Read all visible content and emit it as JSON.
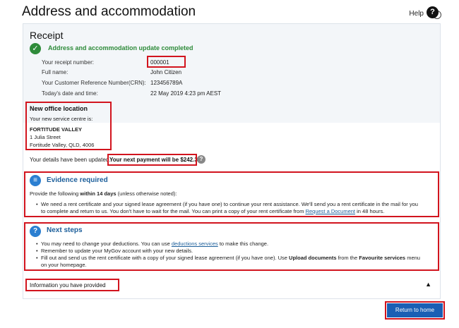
{
  "page": {
    "title": "Address and accommodation",
    "help_label": "Help"
  },
  "receipt": {
    "title": "Receipt",
    "status": "Address and accommodation update completed",
    "fields": [
      {
        "label": "Your receipt number:",
        "value": "000001"
      },
      {
        "label": "Full name:",
        "value": "John Citizen"
      },
      {
        "label": "Your Customer Reference Number(CRN):",
        "value": "123456789A"
      },
      {
        "label": "Today's date and time:",
        "value": "22 May 2019 4:23 pm AEST"
      }
    ]
  },
  "office": {
    "title": "New office location",
    "intro": "Your new service centre is:",
    "name": "FORTITUDE VALLEY",
    "street": "1 Julia Street",
    "suburb": "Fortitude Valley, QLD, 4006"
  },
  "payment": {
    "details_text": "Your details have been updated.",
    "next_payment": "Your next payment will be $242.34"
  },
  "evidence": {
    "title": "Evidence required",
    "intro_pre": "Provide the following ",
    "intro_bold": "within 14 days",
    "intro_post": " (unless otherwise noted):",
    "bullet_line1": "We need a rent certificate and your signed lease agreement (if you have one) to continue your rent assistance. We'll send you a rent certificate in the mail for you",
    "bullet_line2_pre": "to complete and return to us. You don't have to wait for the mail. You can print a copy of your rent certificate from ",
    "bullet_link": "Request a Document",
    "bullet_line2_post": " in 48 hours."
  },
  "next_steps": {
    "title": "Next steps",
    "b1_pre": "You may need to change your deductions. You can use ",
    "b1_link": "deductions services",
    "b1_post": " to make this change.",
    "b2": "Remember to update your MyGov account with your new details.",
    "b3_pre": "Fill out and send us the rent certificate with a copy of your signed lease agreement (if you have one). Use ",
    "b3_bold1": "Upload documents",
    "b3_mid": " from the ",
    "b3_bold2": "Favourite services",
    "b3_post": " menu",
    "b3_line2": "on your homepage."
  },
  "info_section": {
    "label": "Information you have provided"
  },
  "actions": {
    "return_home": "Return to home"
  },
  "colors": {
    "accent": "#1a5fb4",
    "success": "#2e8b3a",
    "highlight": "#d2141e"
  }
}
